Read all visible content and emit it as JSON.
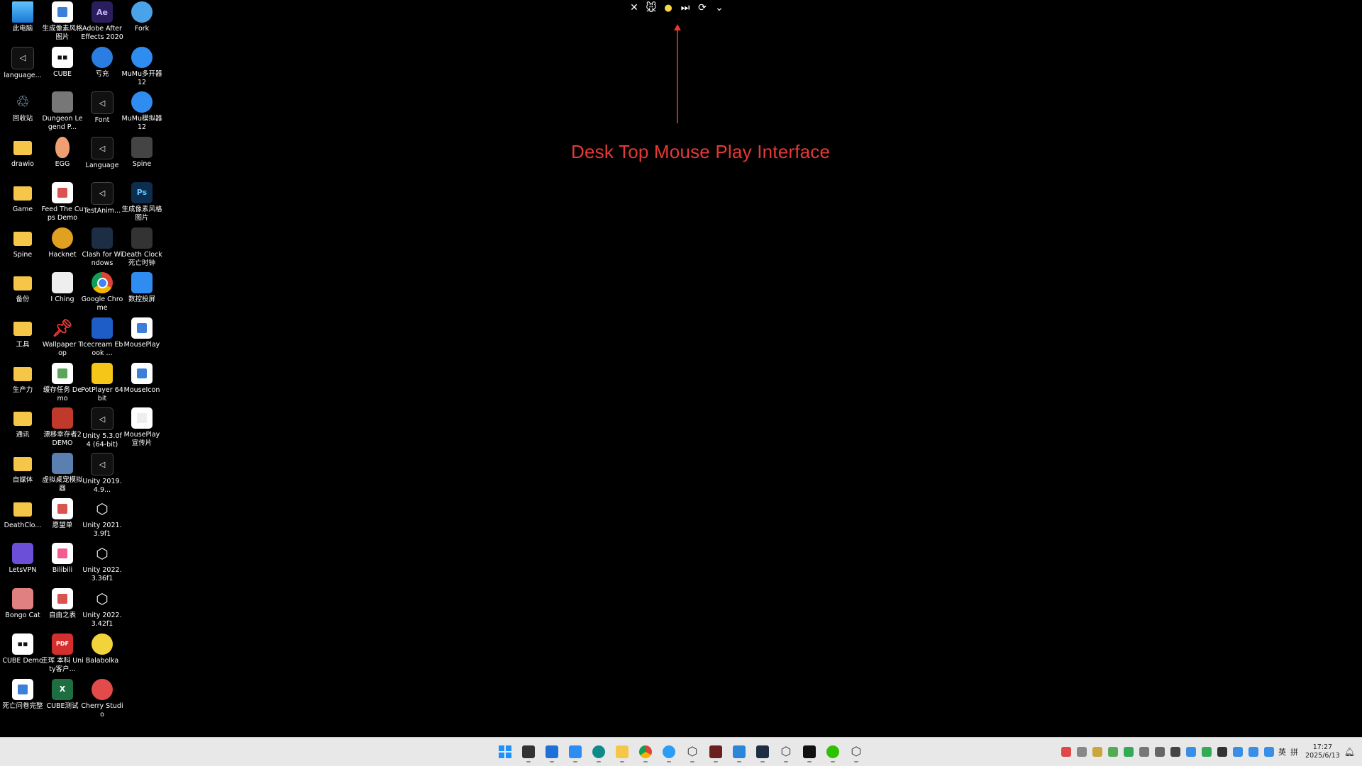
{
  "desktop": {
    "icons": [
      {
        "label": "此电脑",
        "kind": "monitor",
        "color": "#3aa0f0"
      },
      {
        "label": "生成像素风格图片",
        "kind": "doc",
        "color": "#3b7fd9"
      },
      {
        "label": "Adobe After Effects 2020",
        "kind": "ae",
        "color": "#2b1e5c"
      },
      {
        "label": "Fork",
        "kind": "round",
        "color": "#4aa3e8"
      },
      {
        "label": "language...",
        "kind": "unity-dark",
        "color": "#222"
      },
      {
        "label": "CUBE",
        "kind": "cube-white",
        "color": "#fff"
      },
      {
        "label": "亏充",
        "kind": "round",
        "color": "#2a7de1"
      },
      {
        "label": "MuMu多开器12",
        "kind": "mumu",
        "color": "#2f8cf1"
      },
      {
        "label": "回收站",
        "kind": "bin",
        "color": "#9ccff4"
      },
      {
        "label": "Dungeon Legend P...",
        "kind": "square",
        "color": "#777"
      },
      {
        "label": "Font",
        "kind": "unity-dark",
        "color": "#222"
      },
      {
        "label": "MuMu模拟器12",
        "kind": "mumu",
        "color": "#2f8cf1"
      },
      {
        "label": "drawio",
        "kind": "folder",
        "color": "#f6c649"
      },
      {
        "label": "EGG",
        "kind": "egg",
        "color": "#f0a070"
      },
      {
        "label": "Language",
        "kind": "unity-dark",
        "color": "#222"
      },
      {
        "label": "Spine",
        "kind": "spine",
        "color": "#444"
      },
      {
        "label": "Game",
        "kind": "folder",
        "color": "#f6c649"
      },
      {
        "label": "Feed The Cups Demo",
        "kind": "doc",
        "color": "#d9534f"
      },
      {
        "label": "TestAnim...",
        "kind": "unity-dark",
        "color": "#222"
      },
      {
        "label": "生成像素风格图片",
        "kind": "ps",
        "color": "#0d2d4f"
      },
      {
        "label": "Spine",
        "kind": "folder",
        "color": "#f6c649"
      },
      {
        "label": "Hacknet",
        "kind": "round",
        "color": "#e0a020"
      },
      {
        "label": "Clash for Windows",
        "kind": "cat",
        "color": "#1d2d44"
      },
      {
        "label": "Death Clock 死亡时钟",
        "kind": "square",
        "color": "#333"
      },
      {
        "label": "备份",
        "kind": "folder",
        "color": "#f6c649"
      },
      {
        "label": "I Ching",
        "kind": "square",
        "color": "#eee"
      },
      {
        "label": "Google Chrome",
        "kind": "chrome",
        "color": "#db4437"
      },
      {
        "label": "数控投屏",
        "kind": "square",
        "color": "#2f8cf1"
      },
      {
        "label": "工具",
        "kind": "folder",
        "color": "#f6c649"
      },
      {
        "label": "Wallpaper Top",
        "kind": "pin",
        "color": "#e53935"
      },
      {
        "label": "Icecream Ebook ...",
        "kind": "square",
        "color": "#1e5cc8"
      },
      {
        "label": "MousePlay",
        "kind": "doc",
        "color": "#3b7fd9"
      },
      {
        "label": "生产力",
        "kind": "folder",
        "color": "#f6c649"
      },
      {
        "label": "缓存任务 Demo",
        "kind": "doc",
        "color": "#5aa55a"
      },
      {
        "label": "PotPlayer 64 bit",
        "kind": "square",
        "color": "#f5c518"
      },
      {
        "label": "MouseIcon",
        "kind": "doc",
        "color": "#3b7fd9"
      },
      {
        "label": "通讯",
        "kind": "folder",
        "color": "#f6c649"
      },
      {
        "label": "漂移幸存者2 DEMO",
        "kind": "square",
        "color": "#c0392b"
      },
      {
        "label": "Unity 5.3.0f4 (64-bit)",
        "kind": "unity-dark",
        "color": "#222"
      },
      {
        "label": "MousePlay 宣传片",
        "kind": "doc",
        "color": "#eee"
      },
      {
        "label": "自媒体",
        "kind": "folder",
        "color": "#f6c649"
      },
      {
        "label": "虚拟桌宠模拟器",
        "kind": "square",
        "color": "#5a7fb0"
      },
      {
        "label": "Unity 2019.4.9...",
        "kind": "unity-dark",
        "color": "#222"
      },
      {
        "label": "",
        "kind": "none",
        "color": "#000"
      },
      {
        "label": "DeathClo...",
        "kind": "folder",
        "color": "#f6c649"
      },
      {
        "label": "愿望单",
        "kind": "doc",
        "color": "#d9534f"
      },
      {
        "label": "Unity 2021.3.9f1",
        "kind": "unity",
        "color": "#eee"
      },
      {
        "label": "",
        "kind": "none",
        "color": "#000"
      },
      {
        "label": "LetsVPN",
        "kind": "square",
        "color": "#6b4fd8"
      },
      {
        "label": "Bilibili",
        "kind": "doc",
        "color": "#f25d8e"
      },
      {
        "label": "Unity 2022.3.36f1",
        "kind": "unity",
        "color": "#eee"
      },
      {
        "label": "",
        "kind": "none",
        "color": "#000"
      },
      {
        "label": "Bongo Cat",
        "kind": "square",
        "color": "#e08080"
      },
      {
        "label": "自由之表",
        "kind": "doc",
        "color": "#d9534f"
      },
      {
        "label": "Unity 2022.3.42f1",
        "kind": "unity",
        "color": "#eee"
      },
      {
        "label": "",
        "kind": "none",
        "color": "#000"
      },
      {
        "label": "CUBE Demo",
        "kind": "cube-white",
        "color": "#fff"
      },
      {
        "label": "王珲 本科 Unity客户...",
        "kind": "pdf",
        "color": "#d32f2f"
      },
      {
        "label": "Balabolka",
        "kind": "round",
        "color": "#f3d33a"
      },
      {
        "label": "",
        "kind": "none",
        "color": "#000"
      },
      {
        "label": "死亡问卷完整",
        "kind": "doc",
        "color": "#3b7fd9"
      },
      {
        "label": "CUBE测试",
        "kind": "excel",
        "color": "#1d6f42"
      },
      {
        "label": "Cherry Studio",
        "kind": "round",
        "color": "#e34a4a"
      },
      {
        "label": "",
        "kind": "none",
        "color": "#000"
      }
    ]
  },
  "mouseplay_bar": {
    "buttons": [
      {
        "name": "close",
        "glyph": "✕"
      },
      {
        "name": "mouse-avatar",
        "glyph": "🐭"
      },
      {
        "name": "status-dot",
        "glyph": "●"
      },
      {
        "name": "next",
        "glyph": "⏭"
      },
      {
        "name": "refresh",
        "glyph": "⟳"
      },
      {
        "name": "expand",
        "glyph": "⌄"
      }
    ]
  },
  "annotation": {
    "text": "Desk Top Mouse Play Interface",
    "color": "#e53935"
  },
  "taskbar": {
    "apps": [
      {
        "name": "start",
        "color": "#1e90ff"
      },
      {
        "name": "file-explorer-dark",
        "color": "#333"
      },
      {
        "name": "vscode-like",
        "color": "#1e70d8"
      },
      {
        "name": "screen-tool",
        "color": "#2f8cf1"
      },
      {
        "name": "edge",
        "color": "#0f8a8a"
      },
      {
        "name": "folder",
        "color": "#f6c649"
      },
      {
        "name": "chrome",
        "color": "#db4437"
      },
      {
        "name": "chat-bubble",
        "color": "#2a9df4"
      },
      {
        "name": "unity-hub",
        "color": "#333"
      },
      {
        "name": "game-app",
        "color": "#6b1f1f"
      },
      {
        "name": "fork",
        "color": "#2b86d9"
      },
      {
        "name": "clash",
        "color": "#1d2d44"
      },
      {
        "name": "unity",
        "color": "#333"
      },
      {
        "name": "capcut",
        "color": "#111"
      },
      {
        "name": "wechat",
        "color": "#2dc100"
      },
      {
        "name": "unity-2",
        "color": "#333"
      }
    ],
    "tray": {
      "icons": [
        "#e04848",
        "#888",
        "#caa640",
        "#5a5",
        "#3a5",
        "#777",
        "#666",
        "#444",
        "#3a8ee6",
        "#3a5",
        "#333",
        "#3a8ee6",
        "#3a8ee6",
        "#3a8ee6"
      ],
      "ime_lang": "英",
      "ime_mode": "拼",
      "time": "17:27",
      "date": "2025/6/13"
    }
  }
}
